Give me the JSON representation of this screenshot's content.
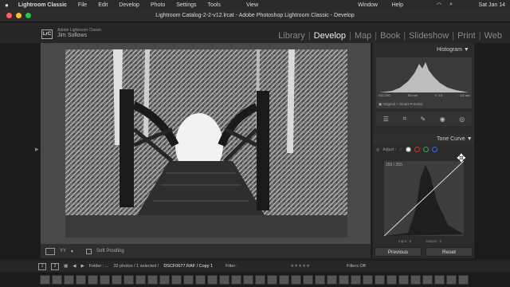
{
  "menubar": {
    "apple": "",
    "items": [
      "Lightroom Classic",
      "File",
      "Edit",
      "Develop",
      "Photo",
      "Settings",
      "Tools"
    ],
    "right_items": [
      "View",
      "Window",
      "Help"
    ],
    "date": "Sat Jan 14"
  },
  "window": {
    "title": "Lightroom Catalog-2-2-v12.lrcat - Adobe Photoshop Lightroom Classic - Develop"
  },
  "identity": {
    "logo": "LrC",
    "app": "Adobe Lightroom Classic",
    "user": "Jim Sollows"
  },
  "modules": [
    "Library",
    "Develop",
    "Map",
    "Book",
    "Slideshow",
    "Print",
    "Web"
  ],
  "active_module": "Develop",
  "histogram": {
    "title": "Histogram",
    "iso": "ISO 200",
    "focal": "50 mm",
    "aperture": "f / 10",
    "shutter": "1/4 sec",
    "preview": "Original + Smart Preview"
  },
  "tone_curve": {
    "title": "Tone Curve",
    "adjust_label": "Adjust :",
    "readout": "255 / 255",
    "input_label": "Input :",
    "input_value": "0",
    "output_label": "Output :",
    "output_value": "0"
  },
  "toolbar": {
    "soft_proofing": "Soft Proofing"
  },
  "buttons": {
    "previous": "Previous",
    "reset": "Reset"
  },
  "filmstrip_bar": {
    "page1": "1",
    "page2": "2",
    "folder": "Folder : ...",
    "count": "32 photos / 1 selected /",
    "filename": "DSCF0677.RAF / Copy 1",
    "filter_label": "Filter :",
    "filters_off": "Filters Off"
  },
  "colors": {
    "accent_white": "#eeeeee",
    "panel_bg": "#2b2b2b",
    "red_dot": "#c0392b",
    "green_dot": "#27ae60",
    "blue_dot": "#2e6bd6"
  }
}
